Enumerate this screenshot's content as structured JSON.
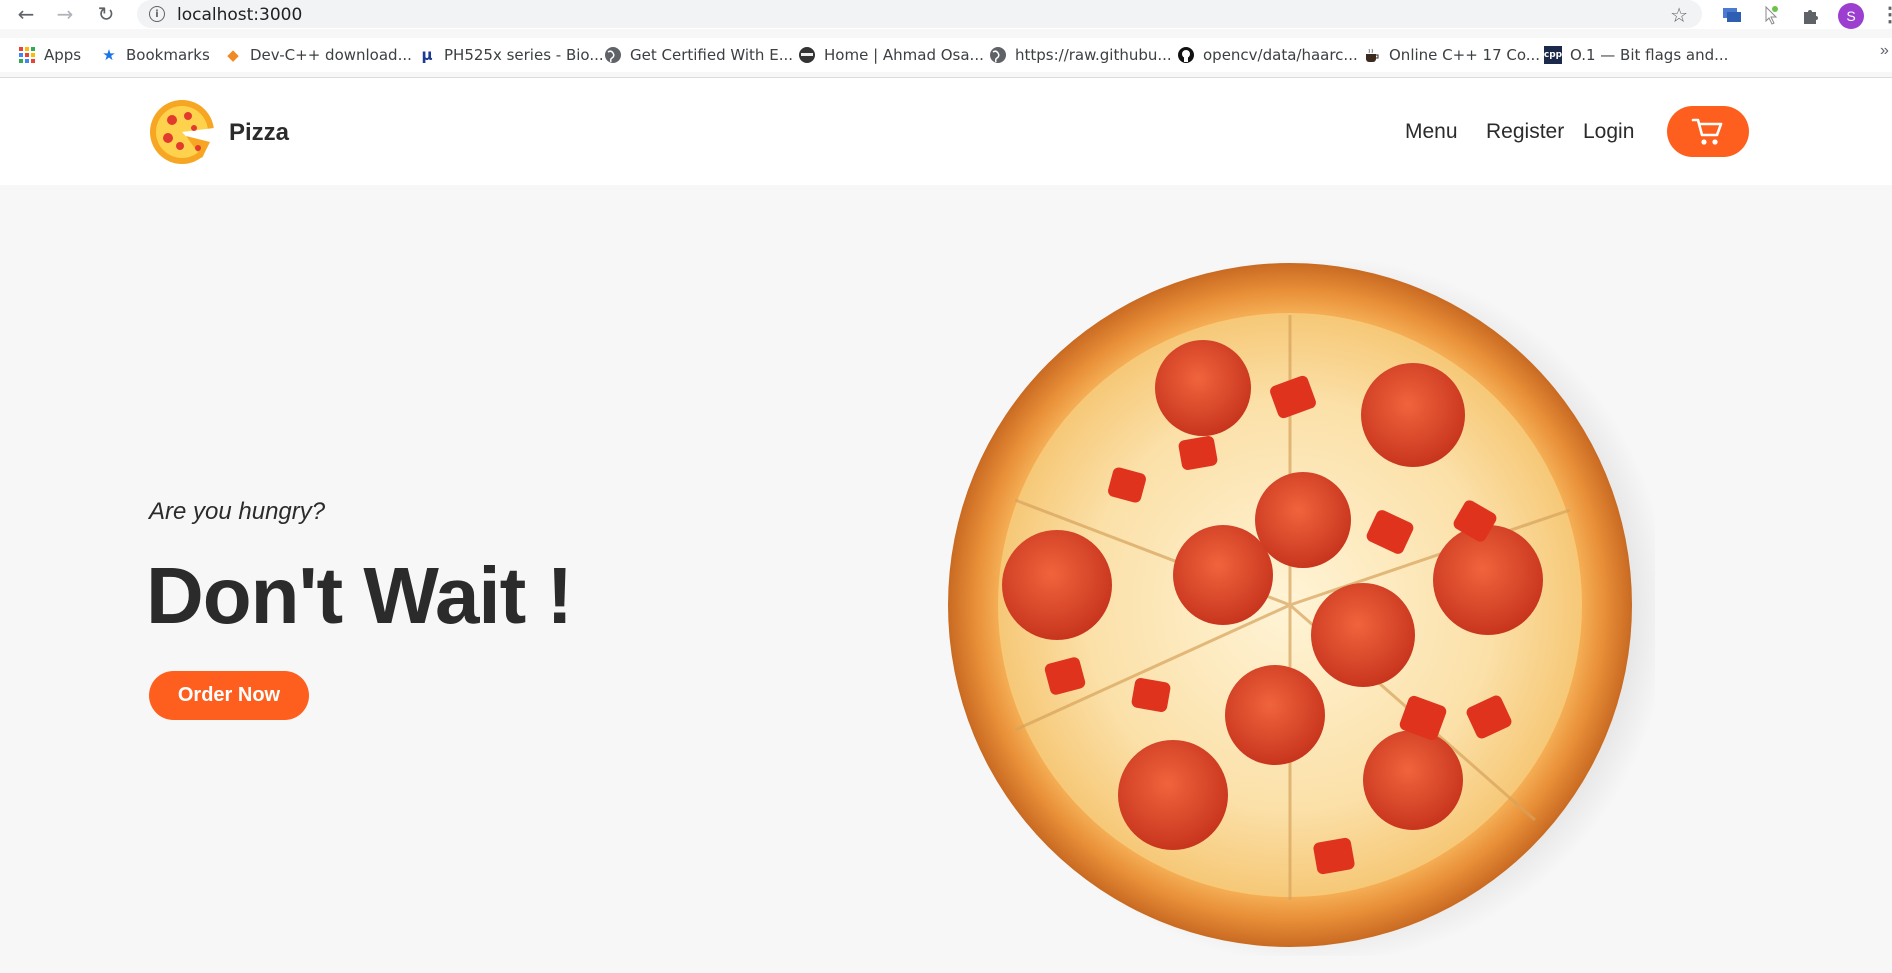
{
  "browser": {
    "url": "localhost:3000",
    "profile_initial": "S"
  },
  "bookmarks": [
    {
      "label": "Apps",
      "icon": "apps-grid-icon"
    },
    {
      "label": "Bookmarks",
      "icon": "star-icon"
    },
    {
      "label": "Dev-C++ download...",
      "icon": "devcpp-icon"
    },
    {
      "label": "PH525x series - Bio...",
      "icon": "mu-icon"
    },
    {
      "label": "Get Certified With E...",
      "icon": "globe-icon"
    },
    {
      "label": "Home | Ahmad Osa...",
      "icon": "ninja-icon"
    },
    {
      "label": "https://raw.githubu...",
      "icon": "globe-icon"
    },
    {
      "label": "opencv/data/haarc...",
      "icon": "github-icon"
    },
    {
      "label": "Online C++ 17 Co...",
      "icon": "coffee-icon"
    },
    {
      "label": "O.1 — Bit flags and...",
      "icon": "cpp-icon"
    }
  ],
  "header": {
    "brand": "Pizza",
    "nav": [
      "Menu",
      "Register",
      "Login"
    ],
    "accent_color": "#fe5f1e"
  },
  "hero": {
    "subtitle": "Are you hungry?",
    "title": "Don't Wait !",
    "cta_label": "Order Now"
  }
}
